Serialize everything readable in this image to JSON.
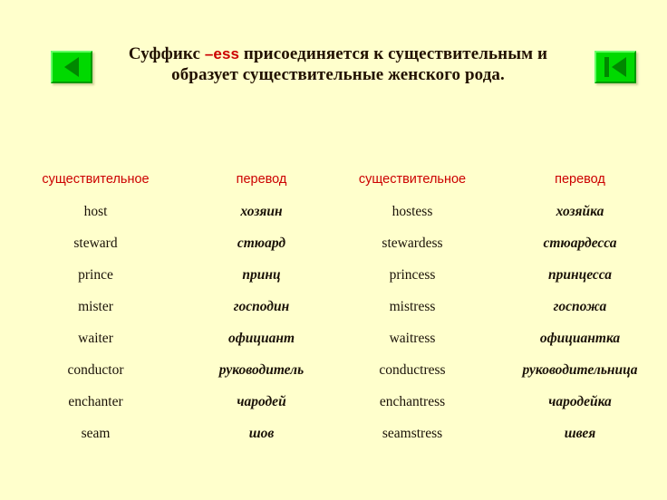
{
  "slide": {
    "background_color": "#FFFFCC",
    "title": {
      "line1_before": "Суффикс ",
      "suffix": "–ess",
      "line1_after": " присоединяется к существительным и",
      "line2": "образует существительные женского рода.",
      "text_color": "#221100",
      "suffix_color": "#CC0000"
    },
    "nav": {
      "prev_label": "",
      "prev_icon": "triangle-left-icon",
      "first_label": "",
      "first_icon": "skip-to-start-icon",
      "button_color": "#00D900",
      "glyph_color": "#008800"
    }
  },
  "table": {
    "header_color": "#CC0000",
    "headers": [
      "существительное",
      "перевод",
      "существительное",
      "перевод"
    ],
    "rows": [
      {
        "masc_en": "host",
        "masc_ru": "хозяин",
        "fem_en": "hostess",
        "fem_ru": "хозяйка"
      },
      {
        "masc_en": "steward",
        "masc_ru": "стюард",
        "fem_en": "stewardess",
        "fem_ru": "стюардесса"
      },
      {
        "masc_en": "prince",
        "masc_ru": "принц",
        "fem_en": "princess",
        "fem_ru": "принцесса"
      },
      {
        "masc_en": "mister",
        "masc_ru": "господин",
        "fem_en": "mistress",
        "fem_ru": "госпожа"
      },
      {
        "masc_en": "waiter",
        "masc_ru": "официант",
        "fem_en": "waitress",
        "fem_ru": "официантка"
      },
      {
        "masc_en": "conductor",
        "masc_ru": "руководитель",
        "fem_en": "conductress",
        "fem_ru": "руководительница"
      },
      {
        "masc_en": "enchanter",
        "masc_ru": "чародей",
        "fem_en": "enchantress",
        "fem_ru": "чародейка"
      },
      {
        "masc_en": "seam",
        "masc_ru": "шов",
        "fem_en": "seamstress",
        "fem_ru": "швея"
      }
    ]
  }
}
